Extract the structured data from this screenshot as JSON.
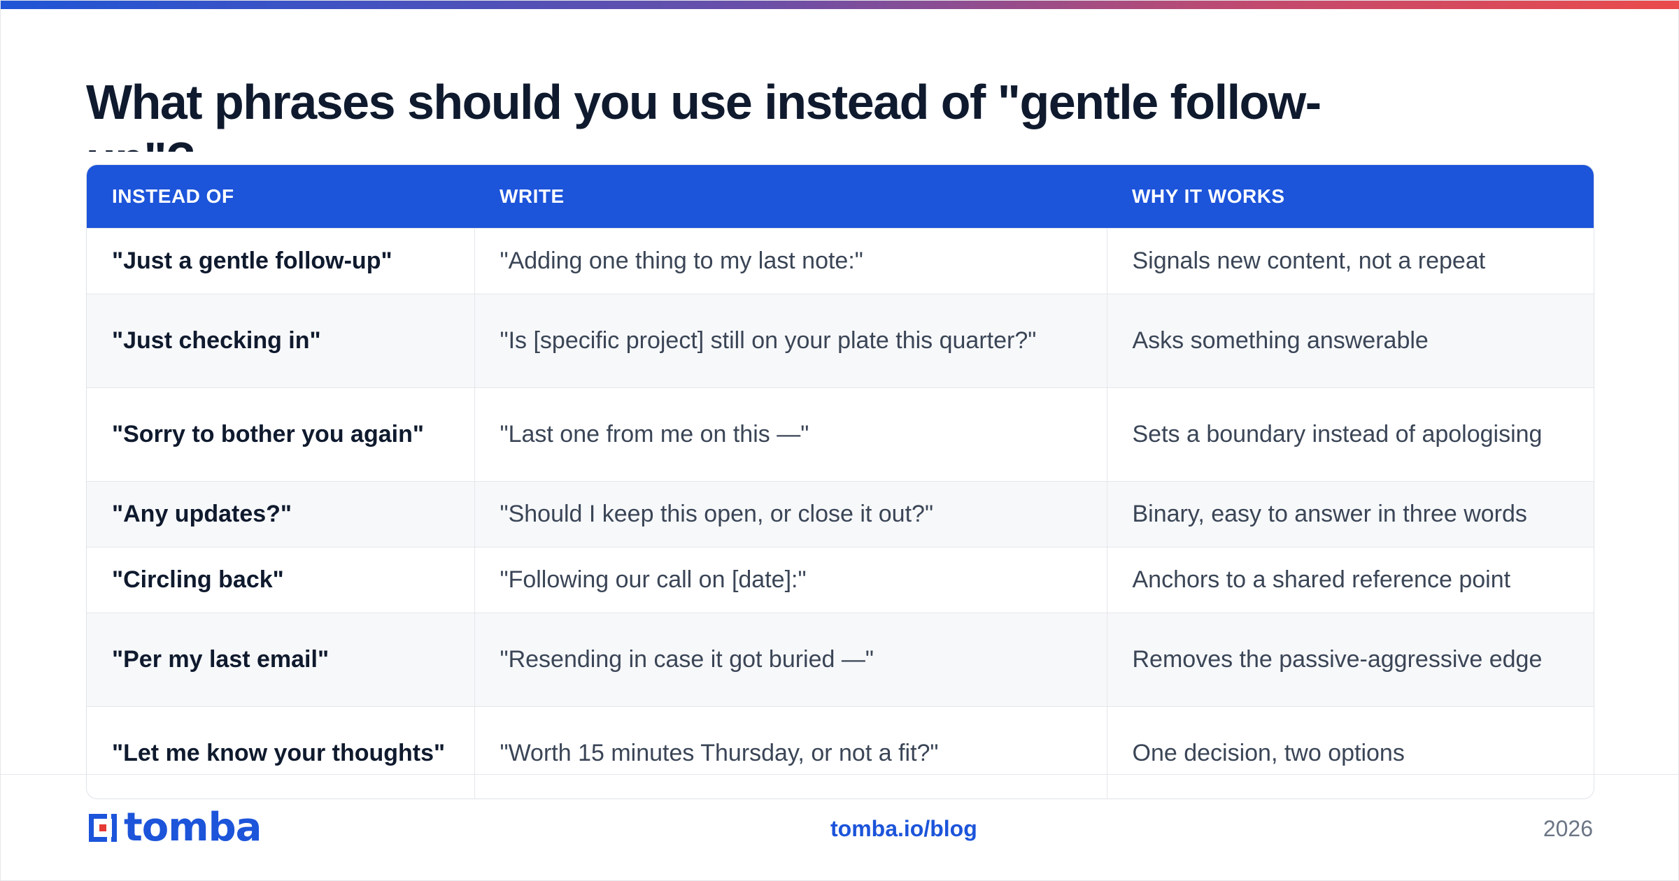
{
  "title": "What phrases should you use instead of \"gentle follow-up\"?",
  "table": {
    "headers": [
      "INSTEAD OF",
      "WRITE",
      "WHY IT WORKS"
    ],
    "rows": [
      {
        "instead": "\"Just a gentle follow-up\"",
        "write": "\"Adding one thing to my last note:\"",
        "why": "Signals new content, not a repeat"
      },
      {
        "instead": "\"Just checking in\"",
        "write": "\"Is [specific project] still on your plate this quarter?\"",
        "why": "Asks something answerable"
      },
      {
        "instead": "\"Sorry to bother you again\"",
        "write": "\"Last one from me on this —\"",
        "why": "Sets a boundary instead of apologising"
      },
      {
        "instead": "\"Any updates?\"",
        "write": "\"Should I keep this open, or close it out?\"",
        "why": "Binary, easy to answer in three words"
      },
      {
        "instead": "\"Circling back\"",
        "write": "\"Following our call on [date]:\"",
        "why": "Anchors to a shared reference point"
      },
      {
        "instead": "\"Per my last email\"",
        "write": "\"Resending in case it got buried —\"",
        "why": "Removes the passive-aggressive edge"
      },
      {
        "instead": "\"Let me know your thoughts\"",
        "write": "\"Worth 15 minutes Thursday, or not a fit?\"",
        "why": "One decision, two options"
      }
    ]
  },
  "footer": {
    "brand": "tomba",
    "link": "tomba.io/blog",
    "year": "2026"
  },
  "colors": {
    "accent": "#1c54da",
    "brand_red": "#e53935",
    "title": "#0f1a2e",
    "gradient_start": "#1f55d6",
    "gradient_end": "#ea4b4b"
  },
  "icons": {
    "logo": "tomba-logo-icon"
  }
}
